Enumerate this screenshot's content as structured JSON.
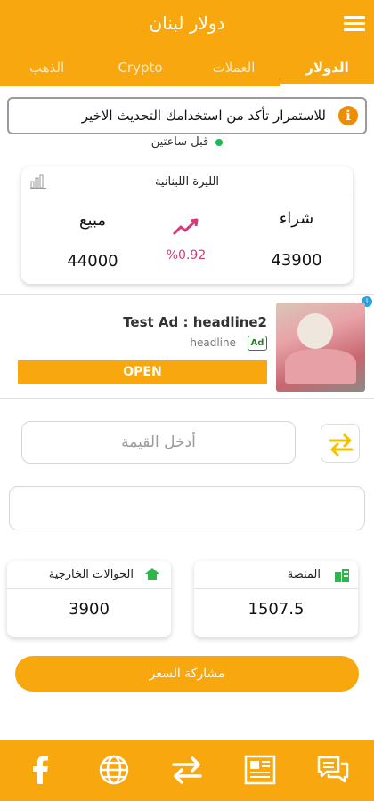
{
  "app": {
    "title": "دولار لبنان"
  },
  "tabs": [
    {
      "label": "الدولار",
      "active": true
    },
    {
      "label": "العملات",
      "active": false
    },
    {
      "label": "Crypto",
      "active": false
    },
    {
      "label": "الذهب",
      "active": false
    }
  ],
  "notice": {
    "text": "للاستمرار تأكد من استخدامك التحديث الاخير"
  },
  "last_update": "قبل ساعتين",
  "rate_card": {
    "title": "الليرة اللبنانية",
    "buy_label": "شراء",
    "sell_label": "مبيع",
    "buy_value": "43900",
    "sell_value": "44000",
    "change": "%0.92"
  },
  "ad": {
    "headline": "Test Ad : headline2",
    "subtitle": "headline",
    "badge": "Ad",
    "cta": "OPEN"
  },
  "converter": {
    "placeholder": "أدخل القيمة",
    "result": ""
  },
  "platform_card": {
    "title": "المنصة",
    "value": "1507.5"
  },
  "transfers_card": {
    "title": "الحوالات الخارجية",
    "value": "3900"
  },
  "share": {
    "label": "مشاركة السعر"
  },
  "colors": {
    "accent": "#F9A70E",
    "change": "#D63A7A",
    "status_dot": "#1db954",
    "house_icon": "#2fb54a"
  },
  "bottom_nav": [
    "facebook-icon",
    "globe-icon",
    "swap-icon",
    "news-icon",
    "chat-icon"
  ]
}
